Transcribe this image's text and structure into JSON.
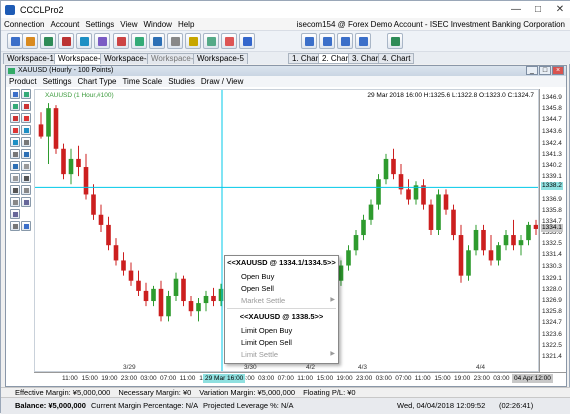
{
  "app": {
    "title": "CCCLPro2"
  },
  "menubar": {
    "items": [
      "Connection",
      "Account",
      "Settings",
      "View",
      "Window",
      "Help"
    ],
    "account": "isecom154 @ Forex Demo Account - ISEC Investment Banking Corporation"
  },
  "workspace_tabs": [
    {
      "label": "Workspace-1",
      "active": false,
      "enabled": true
    },
    {
      "label": "Workspace-2",
      "active": true,
      "enabled": true
    },
    {
      "label": "Workspace-3",
      "active": false,
      "enabled": true
    },
    {
      "label": "Workspace-4",
      "active": false,
      "enabled": false
    },
    {
      "label": "Workspace-5",
      "active": false,
      "enabled": true
    }
  ],
  "chart_tabs": [
    {
      "label": "1. Chart",
      "active": false
    },
    {
      "label": "2. Chart",
      "active": true
    },
    {
      "label": "3. Chart",
      "active": false
    },
    {
      "label": "4. Chart",
      "active": false
    }
  ],
  "chart_window": {
    "title": "XAUUSD (Hourly - 100 Points)"
  },
  "chart_menu": [
    "Product",
    "Settings",
    "Chart Type",
    "Time Scale",
    "Studies",
    "Draw / View"
  ],
  "chart_header": {
    "symbol": "XAUUSD (1 Hour,#100)",
    "ohlc": "29 Mar 2018 16:00 H:1325.6 L:1322.8 O:1323.0 C:1324.7"
  },
  "price_badges": {
    "crosshair": "1338.2",
    "last": "1334.1"
  },
  "time_badges": {
    "crosshair": "29 Mar 16:00",
    "end": "04 Apr 12:00"
  },
  "context_menu": {
    "header1": "<<XAUUSD @ 1334.1/1334.5>>",
    "items1": [
      {
        "label": "Open Buy",
        "enabled": true,
        "submenu": false
      },
      {
        "label": "Open Sell",
        "enabled": true,
        "submenu": false
      },
      {
        "label": "Market Settle",
        "enabled": false,
        "submenu": true
      }
    ],
    "header2": "<<XAUUSD @ 1338.5>>",
    "items2": [
      {
        "label": "Limit Open Buy",
        "enabled": true,
        "submenu": false
      },
      {
        "label": "Limit Open Sell",
        "enabled": true,
        "submenu": false
      },
      {
        "label": "Limit Settle",
        "enabled": false,
        "submenu": true
      }
    ]
  },
  "status": {
    "effective_margin": "Effective Margin: ¥5,000,000",
    "necessary_margin": "Necessary Margin: ¥0",
    "variation_margin": "Variation Margin: ¥5,000,000",
    "floating_pl": "Floating P/L: ¥0"
  },
  "footer": {
    "balance": "Balance: ¥5,000,000",
    "current_margin": "Current Margin Percentage: N/A",
    "projected_leverage": "Projected Leverage %: N/A",
    "datetime": "Wed, 04/04/2018 12:09:52",
    "clock": "(02:26:41)"
  },
  "colors": {
    "up": "#2e9b2e",
    "down": "#cc1f1f",
    "crosshair": "#00c8e8"
  },
  "icons": {
    "close": "close-icon",
    "minimize": "minimize-icon",
    "maximize": "maximize-icon"
  },
  "chart_data": {
    "type": "candlestick",
    "symbol": "XAUUSD",
    "ylim": [
      1320.7,
      1347.0
    ],
    "y_ticks": [
      "1346.9",
      "1345.8",
      "1344.7",
      "1343.6",
      "1342.4",
      "1341.3",
      "1340.2",
      "1339.1",
      "1338.0",
      "1336.9",
      "1335.8",
      "1334.7",
      "1333.6",
      "1332.5",
      "1331.4",
      "1330.3",
      "1329.1",
      "1328.0",
      "1326.9",
      "1325.8",
      "1324.7",
      "1323.6",
      "1322.5",
      "1321.4"
    ],
    "x_ticks": [
      "11:00",
      "15:00",
      "19:00",
      "23:00",
      "03:00",
      "07:00",
      "11:00",
      "15:00",
      "19:00",
      "23:00",
      "03:00",
      "07:00",
      "11:00",
      "15:00",
      "19:00",
      "23:00",
      "03:00",
      "07:00",
      "11:00",
      "15:00",
      "19:00",
      "23:00",
      "03:00",
      "07:00",
      "11:00"
    ],
    "date_labels": [
      "3/29",
      "3/30",
      "4/2",
      "4/3",
      "4/4"
    ],
    "candles": [
      {
        "o": 1344.4,
        "h": 1345.6,
        "l": 1343.0,
        "c": 1343.2
      },
      {
        "o": 1343.2,
        "h": 1346.5,
        "l": 1340.5,
        "c": 1346.0
      },
      {
        "o": 1346.0,
        "h": 1346.3,
        "l": 1341.5,
        "c": 1342.0
      },
      {
        "o": 1342.0,
        "h": 1342.5,
        "l": 1339.0,
        "c": 1339.5
      },
      {
        "o": 1339.5,
        "h": 1342.0,
        "l": 1338.5,
        "c": 1341.0
      },
      {
        "o": 1341.0,
        "h": 1342.3,
        "l": 1339.3,
        "c": 1340.2
      },
      {
        "o": 1340.2,
        "h": 1341.5,
        "l": 1337.0,
        "c": 1337.5
      },
      {
        "o": 1337.5,
        "h": 1338.5,
        "l": 1335.0,
        "c": 1335.5
      },
      {
        "o": 1335.5,
        "h": 1336.5,
        "l": 1333.8,
        "c": 1334.5
      },
      {
        "o": 1334.5,
        "h": 1335.3,
        "l": 1332.0,
        "c": 1332.5
      },
      {
        "o": 1332.5,
        "h": 1333.2,
        "l": 1330.5,
        "c": 1331.0
      },
      {
        "o": 1331.0,
        "h": 1331.8,
        "l": 1329.5,
        "c": 1330.0
      },
      {
        "o": 1330.0,
        "h": 1330.8,
        "l": 1328.5,
        "c": 1329.0
      },
      {
        "o": 1329.0,
        "h": 1330.0,
        "l": 1327.5,
        "c": 1328.0
      },
      {
        "o": 1328.0,
        "h": 1328.8,
        "l": 1326.5,
        "c": 1327.0
      },
      {
        "o": 1327.0,
        "h": 1328.5,
        "l": 1326.5,
        "c": 1328.2
      },
      {
        "o": 1328.2,
        "h": 1329.0,
        "l": 1325.0,
        "c": 1325.5
      },
      {
        "o": 1325.5,
        "h": 1328.0,
        "l": 1325.0,
        "c": 1327.5
      },
      {
        "o": 1327.5,
        "h": 1329.8,
        "l": 1327.0,
        "c": 1329.2
      },
      {
        "o": 1329.2,
        "h": 1329.5,
        "l": 1326.5,
        "c": 1327.0
      },
      {
        "o": 1327.0,
        "h": 1327.5,
        "l": 1325.5,
        "c": 1326.0
      },
      {
        "o": 1326.0,
        "h": 1327.3,
        "l": 1325.0,
        "c": 1326.8
      },
      {
        "o": 1326.8,
        "h": 1328.0,
        "l": 1326.0,
        "c": 1327.5
      },
      {
        "o": 1327.5,
        "h": 1328.3,
        "l": 1326.5,
        "c": 1327.0
      },
      {
        "o": 1327.0,
        "h": 1328.7,
        "l": 1326.5,
        "c": 1328.2
      },
      {
        "o": 1328.2,
        "h": 1328.9,
        "l": 1326.3,
        "c": 1326.8
      },
      {
        "o": 1326.8,
        "h": 1327.2,
        "l": 1322.5,
        "c": 1323.0
      },
      {
        "o": 1323.0,
        "h": 1324.5,
        "l": 1322.5,
        "c": 1324.2
      },
      {
        "o": 1324.2,
        "h": 1326.0,
        "l": 1323.5,
        "c": 1325.6
      },
      {
        "o": 1325.6,
        "h": 1326.0,
        "l": 1324.0,
        "c": 1324.5
      },
      {
        "o": 1324.5,
        "h": 1325.5,
        "l": 1323.0,
        "c": 1323.5
      },
      {
        "o": 1323.5,
        "h": 1325.0,
        "l": 1323.0,
        "c": 1324.8
      },
      {
        "o": 1324.8,
        "h": 1325.5,
        "l": 1322.0,
        "c": 1322.5
      },
      {
        "o": 1322.5,
        "h": 1323.5,
        "l": 1321.5,
        "c": 1323.0
      },
      {
        "o": 1323.0,
        "h": 1325.0,
        "l": 1322.8,
        "c": 1324.7
      },
      {
        "o": 1324.7,
        "h": 1326.5,
        "l": 1324.0,
        "c": 1326.0
      },
      {
        "o": 1326.0,
        "h": 1327.5,
        "l": 1325.5,
        "c": 1327.0
      },
      {
        "o": 1327.0,
        "h": 1328.0,
        "l": 1325.8,
        "c": 1326.3
      },
      {
        "o": 1326.3,
        "h": 1328.5,
        "l": 1326.0,
        "c": 1328.0
      },
      {
        "o": 1328.0,
        "h": 1329.5,
        "l": 1327.5,
        "c": 1329.0
      },
      {
        "o": 1329.0,
        "h": 1331.0,
        "l": 1328.5,
        "c": 1330.5
      },
      {
        "o": 1330.5,
        "h": 1332.5,
        "l": 1330.0,
        "c": 1332.0
      },
      {
        "o": 1332.0,
        "h": 1334.0,
        "l": 1331.5,
        "c": 1333.5
      },
      {
        "o": 1333.5,
        "h": 1335.5,
        "l": 1333.0,
        "c": 1335.0
      },
      {
        "o": 1335.0,
        "h": 1337.0,
        "l": 1334.5,
        "c": 1336.5
      },
      {
        "o": 1336.5,
        "h": 1339.5,
        "l": 1336.0,
        "c": 1339.0
      },
      {
        "o": 1339.0,
        "h": 1341.5,
        "l": 1338.5,
        "c": 1341.0
      },
      {
        "o": 1341.0,
        "h": 1342.0,
        "l": 1339.0,
        "c": 1339.5
      },
      {
        "o": 1339.5,
        "h": 1340.5,
        "l": 1337.5,
        "c": 1338.0
      },
      {
        "o": 1338.0,
        "h": 1339.0,
        "l": 1336.5,
        "c": 1337.0
      },
      {
        "o": 1337.0,
        "h": 1338.8,
        "l": 1336.5,
        "c": 1338.4
      },
      {
        "o": 1338.4,
        "h": 1339.0,
        "l": 1336.0,
        "c": 1336.5
      },
      {
        "o": 1336.5,
        "h": 1337.0,
        "l": 1333.5,
        "c": 1334.0
      },
      {
        "o": 1334.0,
        "h": 1338.0,
        "l": 1333.5,
        "c": 1337.5
      },
      {
        "o": 1337.5,
        "h": 1338.0,
        "l": 1335.5,
        "c": 1336.0
      },
      {
        "o": 1336.0,
        "h": 1336.5,
        "l": 1333.0,
        "c": 1333.5
      },
      {
        "o": 1333.5,
        "h": 1334.5,
        "l": 1328.8,
        "c": 1329.5
      },
      {
        "o": 1329.5,
        "h": 1332.5,
        "l": 1329.0,
        "c": 1332.0
      },
      {
        "o": 1332.0,
        "h": 1334.5,
        "l": 1331.5,
        "c": 1334.0
      },
      {
        "o": 1334.0,
        "h": 1334.5,
        "l": 1331.5,
        "c": 1332.0
      },
      {
        "o": 1332.0,
        "h": 1333.5,
        "l": 1330.5,
        "c": 1331.0
      },
      {
        "o": 1331.0,
        "h": 1332.8,
        "l": 1330.5,
        "c": 1332.5
      },
      {
        "o": 1332.5,
        "h": 1334.0,
        "l": 1332.0,
        "c": 1333.5
      },
      {
        "o": 1333.5,
        "h": 1335.0,
        "l": 1332.0,
        "c": 1332.5
      },
      {
        "o": 1332.5,
        "h": 1333.5,
        "l": 1331.5,
        "c": 1333.0
      },
      {
        "o": 1333.0,
        "h": 1334.8,
        "l": 1332.5,
        "c": 1334.5
      },
      {
        "o": 1334.5,
        "h": 1335.0,
        "l": 1333.5,
        "c": 1334.1
      }
    ]
  }
}
